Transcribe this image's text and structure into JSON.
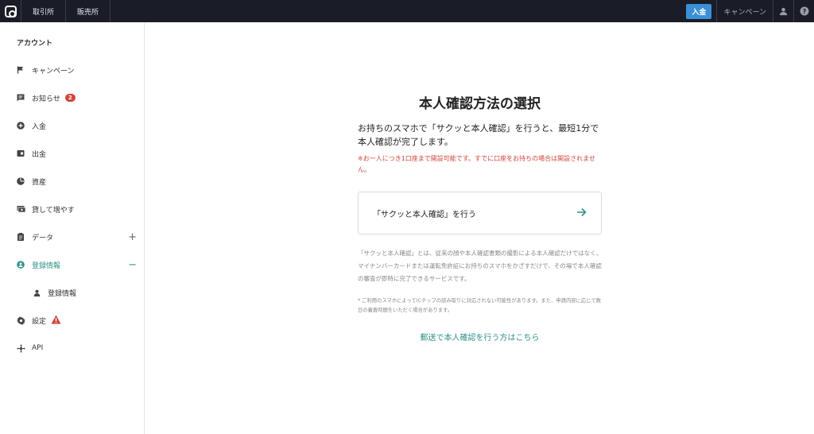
{
  "topbar": {
    "tabs": [
      "取引所",
      "販売所"
    ],
    "deposit_label": "入金",
    "campaign_label": "キャンペーン"
  },
  "sidebar": {
    "heading": "アカウント",
    "items": [
      {
        "label": "キャンペーン",
        "icon": "flag-icon"
      },
      {
        "label": "お知らせ",
        "icon": "message-icon",
        "badge": "2"
      },
      {
        "label": "入金",
        "icon": "plus-circle-icon"
      },
      {
        "label": "出金",
        "icon": "wallet-icon"
      },
      {
        "label": "資産",
        "icon": "pie-chart-icon"
      },
      {
        "label": "貸して増やす",
        "icon": "cash-icon"
      },
      {
        "label": "データ",
        "icon": "clipboard-icon",
        "toggle": "+"
      },
      {
        "label": "登録情報",
        "icon": "account-circle-icon",
        "toggle": "−",
        "active": true
      },
      {
        "label": "登録情報",
        "icon": "person-icon",
        "sub": true
      },
      {
        "label": "設定",
        "icon": "gear-icon",
        "warning": true
      },
      {
        "label": "API",
        "icon": "api-icon"
      }
    ],
    "active_color": "#2f9186"
  },
  "main": {
    "title": "本人確認方法の選択",
    "lead": "お持ちのスマホで「サクッと本人確認」を行うと、最短1分で本人確認が完了します。",
    "note_red": "※お一人につき1口座まで開設可能です。すでに口座をお持ちの場合は開設されません。",
    "action_label": "「サクッと本人確認」を行う",
    "description": "「サクッと本人確認」とは、従来の顔や本人確認書類の撮影による本人確認だけではなく、マイナンバーカードまたは運転免許証にお持ちのスマホをかざすだけで、その場で本人確認の審査が即時に完了できるサービスです。",
    "small_note": "* ご利用のスマホによってICチップの読み取りに対応されない可能性があります。また、申請内容に応じて数日の審査時間をいただく場合があります。",
    "mail_link": "郵送で本人確認を行う方はこちら"
  },
  "colors": {
    "topbar_bg": "#1a1c27",
    "accent": "#2f9186",
    "deposit_button": "#3b8fd6",
    "alert": "#d0463c"
  }
}
